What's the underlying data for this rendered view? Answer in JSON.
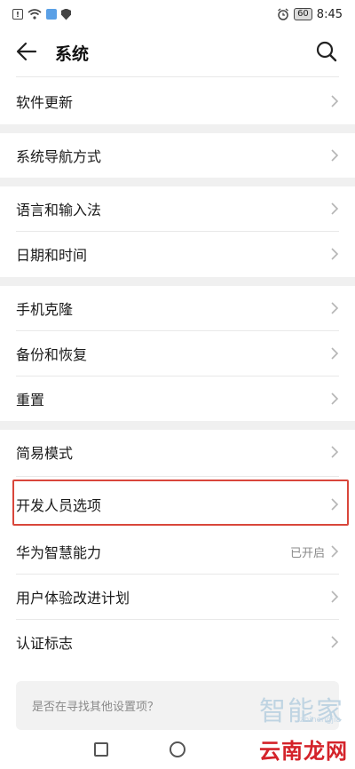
{
  "status_bar": {
    "time": "8:45",
    "battery": "60"
  },
  "header": {
    "title": "系统"
  },
  "settings": [
    {
      "label": "软件更新",
      "value": ""
    },
    {
      "label": "系统导航方式",
      "value": ""
    },
    {
      "label": "语言和输入法",
      "value": ""
    },
    {
      "label": "日期和时间",
      "value": ""
    },
    {
      "label": "手机克隆",
      "value": ""
    },
    {
      "label": "备份和恢复",
      "value": ""
    },
    {
      "label": "重置",
      "value": ""
    },
    {
      "label": "简易模式",
      "value": ""
    },
    {
      "label": "开发人员选项",
      "value": ""
    },
    {
      "label": "华为智慧能力",
      "value": "已开启"
    },
    {
      "label": "用户体验改进计划",
      "value": ""
    },
    {
      "label": "认证标志",
      "value": ""
    }
  ],
  "suggestion": {
    "text": "是否在寻找其他设置项？"
  },
  "watermark": {
    "brand1": "智能家",
    "brand1_sub": "zhinengjia",
    "brand2": "云南龙网"
  },
  "colors": {
    "highlight": "#d9463b",
    "section_gap": "#f0f0f0"
  }
}
